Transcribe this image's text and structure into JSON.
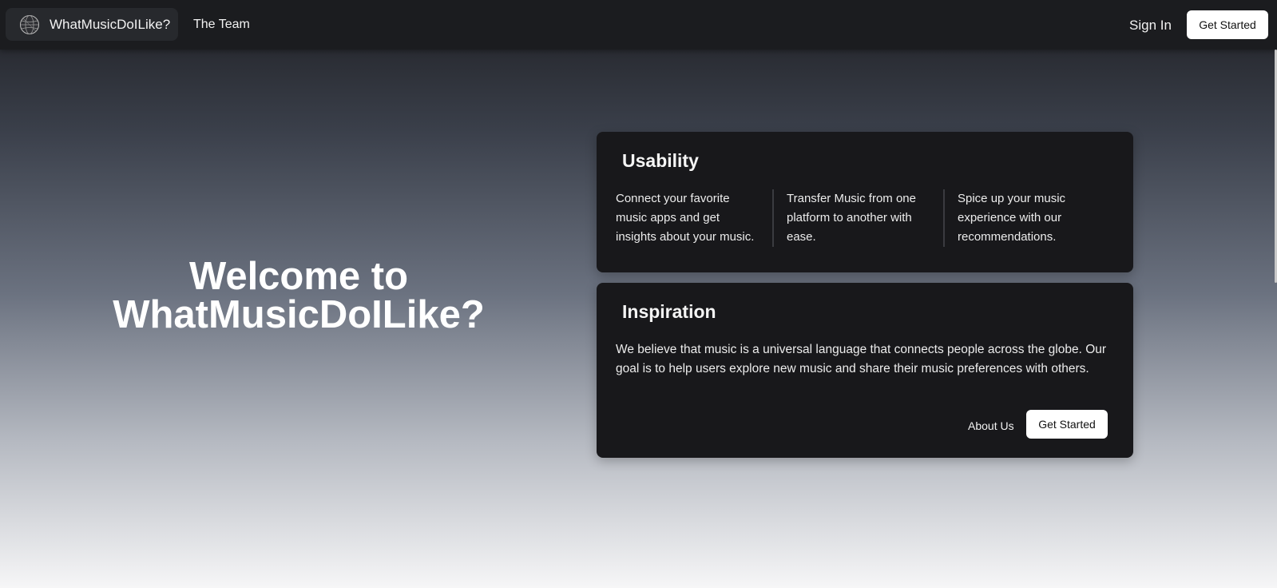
{
  "nav": {
    "brand_name": "WhatMusicDoILike?",
    "brand_icon": "globe-icon",
    "team_link": "The Team",
    "sign_in": "Sign In",
    "get_started": "Get Started"
  },
  "hero": {
    "title_line1": "Welcome to",
    "title_line2": "WhatMusicDoILike?"
  },
  "usability": {
    "title": "Usability",
    "features": [
      "Connect your favorite music apps and get insights about your music.",
      "Transfer Music from one platform to another with ease.",
      "Spice up your music experience with our recommendations."
    ]
  },
  "inspiration": {
    "title": "Inspiration",
    "text": "We believe that music is a universal language that connects people across the globe. Our goal is to help users explore new music and share their music preferences with others.",
    "about_link": "About Us",
    "get_started": "Get Started"
  },
  "colors": {
    "navbar_bg": "#1b1c1f",
    "card_bg": "#18181b",
    "button_bg": "#ffffff"
  }
}
